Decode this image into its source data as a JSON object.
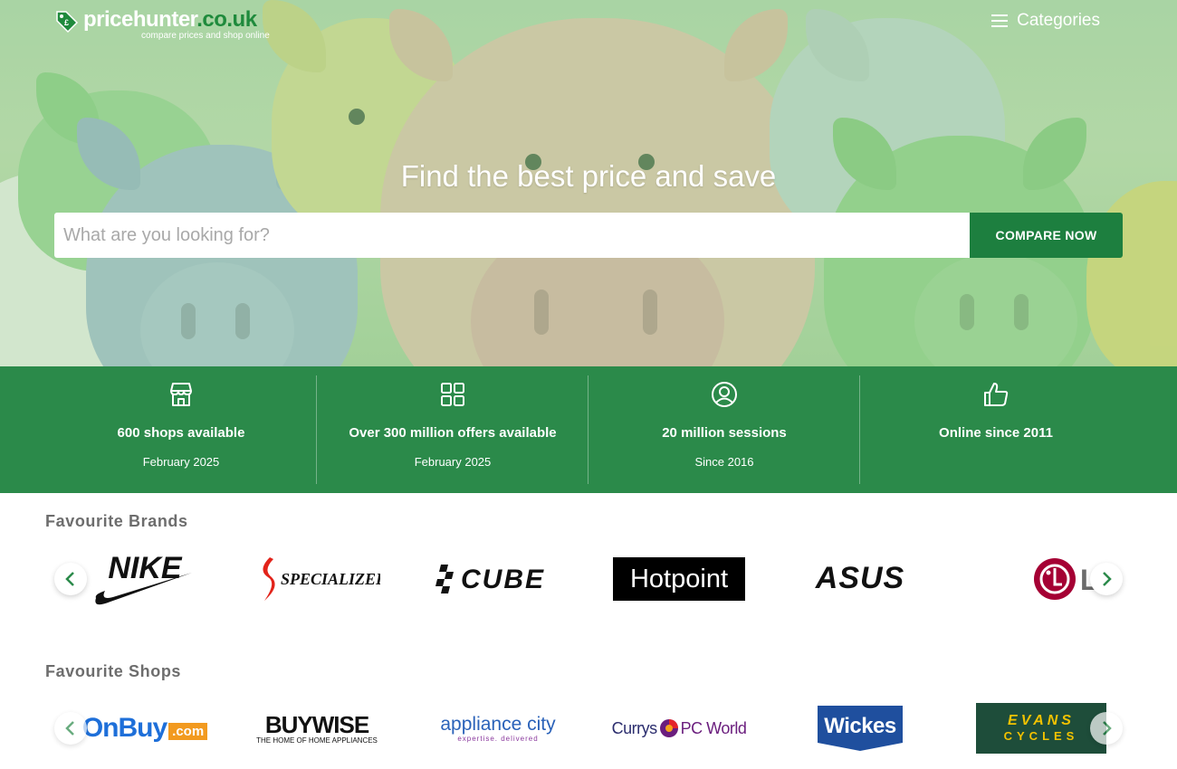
{
  "header": {
    "logo_name": "pricehunter",
    "logo_tld": ".co.uk",
    "logo_tagline": "compare prices and shop online",
    "categories_label": "Categories"
  },
  "hero": {
    "title": "Find the best price and save",
    "search_placeholder": "What are you looking for?",
    "compare_button": "COMPARE NOW"
  },
  "stats": [
    {
      "icon": "shop-icon",
      "title": "600 shops available",
      "subtitle": "February 2025"
    },
    {
      "icon": "grid-icon",
      "title": "Over 300 million offers available",
      "subtitle": "February 2025"
    },
    {
      "icon": "user-icon",
      "title": "20 million sessions",
      "subtitle": "Since 2016"
    },
    {
      "icon": "thumbs-up-icon",
      "title": "Online since 2011",
      "subtitle": ""
    }
  ],
  "brands": {
    "title": "Favourite Brands",
    "items": [
      "NIKE",
      "SPECIALIZED",
      "CUBE",
      "Hotpoint",
      "ASUS",
      "LG"
    ]
  },
  "shops": {
    "title": "Favourite Shops",
    "items": [
      {
        "name": "OnBuy",
        "suffix": ".com"
      },
      {
        "name": "BUYWISE",
        "tagline": "THE HOME OF HOME APPLIANCES"
      },
      {
        "name": "appliance city",
        "tagline": "expertise. delivered"
      },
      {
        "name": "Currys",
        "name2": "PC World"
      },
      {
        "name": "Wickes"
      },
      {
        "name": "EVANS",
        "tagline": "CYCLES"
      }
    ]
  },
  "colors": {
    "brand_green": "#1d7f3f",
    "stats_green": "#2b8a4a",
    "section_title": "#6d6d6d"
  }
}
